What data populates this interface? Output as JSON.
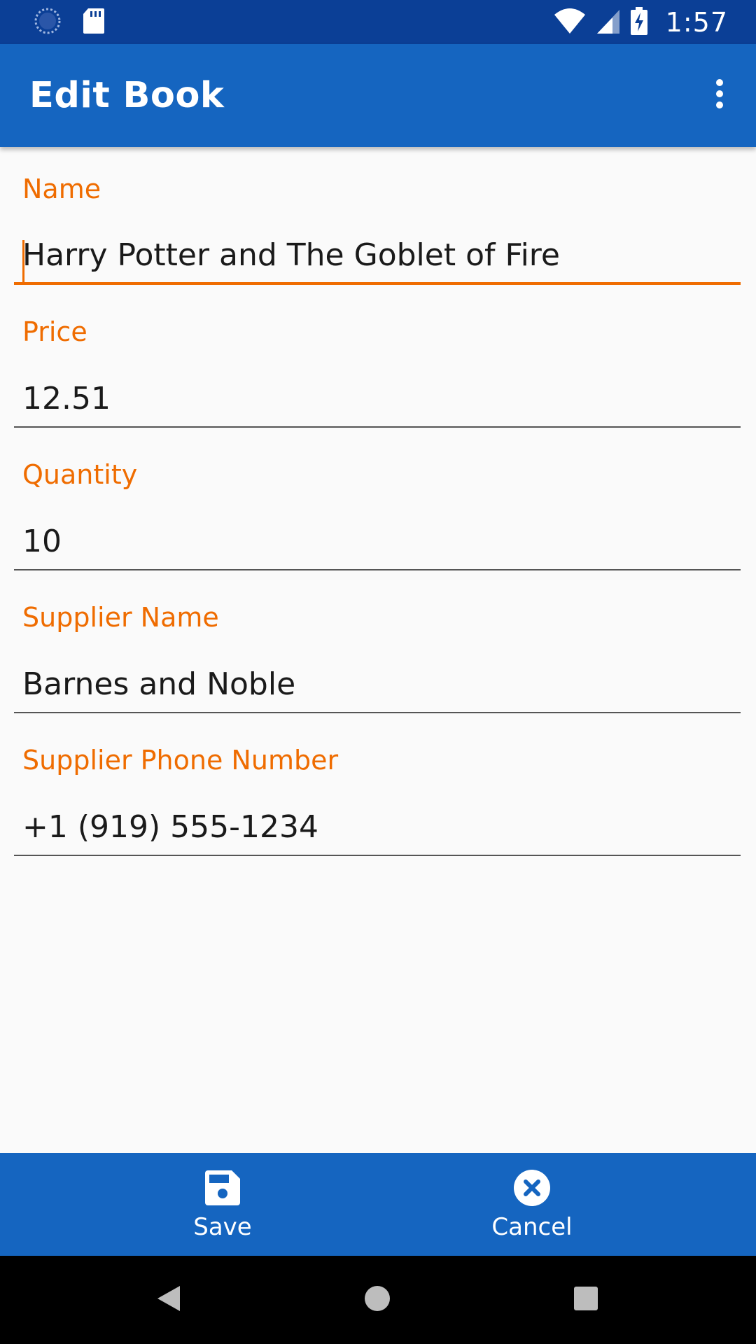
{
  "status_bar": {
    "time": "1:57",
    "icons": [
      "sync-icon",
      "sd-card-icon",
      "wifi-icon",
      "signal-icon",
      "battery-charging-icon"
    ]
  },
  "app_bar": {
    "title": "Edit Book",
    "overflow_icon": "more-vert-icon"
  },
  "form": {
    "fields": [
      {
        "label": "Name",
        "value": "Harry Potter and The Goblet of Fire",
        "focused": true
      },
      {
        "label": "Price",
        "value": "12.51"
      },
      {
        "label": "Quantity",
        "value": "10"
      },
      {
        "label": "Supplier Name",
        "value": "Barnes and Noble"
      },
      {
        "label": "Supplier Phone Number",
        "value": "+1 (919) 555-1234"
      }
    ]
  },
  "actions": {
    "save_label": "Save",
    "save_icon": "save-icon",
    "cancel_label": "Cancel",
    "cancel_icon": "cancel-icon"
  },
  "nav_bar": {
    "icons": [
      "back-icon",
      "home-icon",
      "recents-icon"
    ]
  },
  "colors": {
    "status_bar": "#0b3f96",
    "primary": "#1565c0",
    "accent": "#ef6c00",
    "background": "#fafafa",
    "nav_bar": "#000000"
  }
}
